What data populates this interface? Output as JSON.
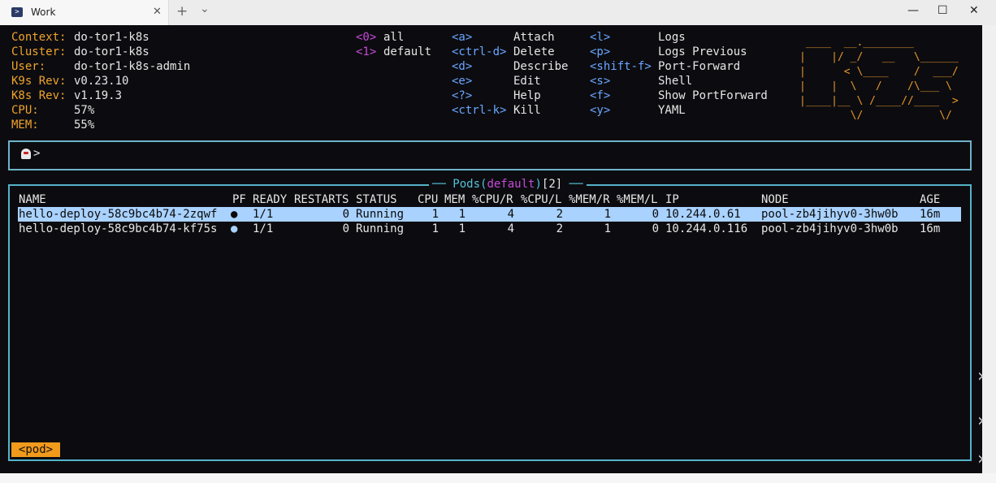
{
  "window": {
    "tab_title": "Work",
    "tab_icon": "terminal-icon",
    "new_tab": "+",
    "dropdown": "⌄",
    "minimize": "—",
    "maximize": "☐",
    "close": "✕",
    "tab_close": "✕"
  },
  "info": [
    {
      "label": "Context:",
      "value": "do-tor1-k8s"
    },
    {
      "label": "Cluster:",
      "value": "do-tor1-k8s"
    },
    {
      "label": "User:",
      "value": "do-tor1-k8s-admin"
    },
    {
      "label": "K9s Rev:",
      "value": "v0.23.10"
    },
    {
      "label": "K8s Rev:",
      "value": "v1.19.3"
    },
    {
      "label": "CPU:",
      "value": "57%"
    },
    {
      "label": "MEM:",
      "value": "55%"
    }
  ],
  "namespaces": [
    {
      "key": "<0>",
      "name": "all"
    },
    {
      "key": "<1>",
      "name": "default"
    }
  ],
  "shortcuts_col1": [
    {
      "key": "<a>",
      "action": "Attach"
    },
    {
      "key": "<ctrl-d>",
      "action": "Delete"
    },
    {
      "key": "<d>",
      "action": "Describe"
    },
    {
      "key": "<e>",
      "action": "Edit"
    },
    {
      "key": "<?>",
      "action": "Help"
    },
    {
      "key": "<ctrl-k>",
      "action": "Kill"
    }
  ],
  "shortcuts_col2": [
    {
      "key": "<l>",
      "action": "Logs"
    },
    {
      "key": "<p>",
      "action": "Logs Previous"
    },
    {
      "key": "<shift-f>",
      "action": "Port-Forward"
    },
    {
      "key": "<s>",
      "action": "Shell"
    },
    {
      "key": "<f>",
      "action": "Show PortForward"
    },
    {
      "key": "<y>",
      "action": "YAML"
    }
  ],
  "logo": " ____  __.________\n|    |/ _/   __   \\______\n|      < \\____    /  ___/\n|    |  \\   /    /\\___ \\\n|____|__ \\ /____//____  >\n        \\/            \\/",
  "prompt": {
    "symbol": ">"
  },
  "panel": {
    "resource": "Pods",
    "paren_open": "(",
    "namespace": "default",
    "paren_close": ")",
    "count": "[2]",
    "dash_left": "──",
    "dash_right": "──"
  },
  "table": {
    "headers": [
      "NAME",
      "PF",
      "READY",
      "RESTARTS",
      "STATUS",
      "CPU",
      "MEM",
      "%CPU/R",
      "%CPU/L",
      "%MEM/R",
      "%MEM/L",
      "IP",
      "NODE",
      "AGE"
    ],
    "rows": [
      [
        "hello-deploy-58c9bc4b74-2zqwf",
        "●",
        "1/1",
        "0",
        "Running",
        "1",
        "1",
        "4",
        "2",
        "1",
        "0",
        "10.244.0.61",
        "pool-zb4jihyv0-3hw0b",
        "16m"
      ],
      [
        "hello-deploy-58c9bc4b74-kf75s",
        "●",
        "1/1",
        "0",
        "Running",
        "1",
        "1",
        "4",
        "2",
        "1",
        "0",
        "10.244.0.116",
        "pool-zb4jihyv0-3hw0b",
        "16m"
      ]
    ],
    "selected_row": 0
  },
  "crumb": "<pod>",
  "colors": {
    "label": "#f0a32b",
    "key": "#6aa6ff",
    "namespace_key": "#c64ad8",
    "border": "#55b3c9",
    "selection": "#a9d2ff",
    "crumb": "#f29a1c"
  }
}
